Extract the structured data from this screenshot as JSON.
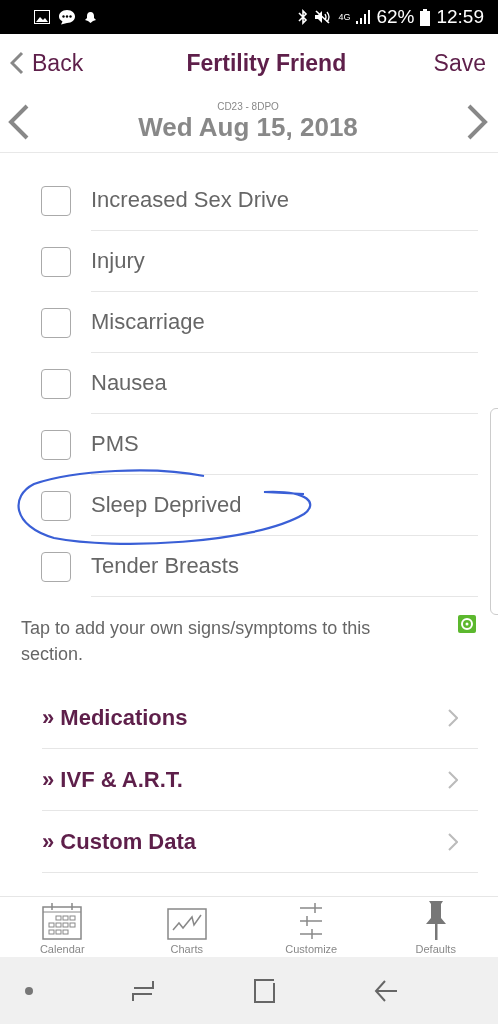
{
  "status_bar": {
    "network": "4G",
    "battery": "62%",
    "time": "12:59"
  },
  "header": {
    "back": "Back",
    "title": "Fertility Friend",
    "save": "Save"
  },
  "date_bar": {
    "cycle": "CD23 - 8DPO",
    "date": "Wed Aug 15, 2018"
  },
  "symptoms": [
    {
      "label": "Increased Sex Drive",
      "checked": false
    },
    {
      "label": "Injury",
      "checked": false
    },
    {
      "label": "Miscarriage",
      "checked": false
    },
    {
      "label": "Nausea",
      "checked": false
    },
    {
      "label": "PMS",
      "checked": false
    },
    {
      "label": "Sleep Deprived",
      "checked": false
    },
    {
      "label": "Tender Breasts",
      "checked": false
    }
  ],
  "note": "Tap to add your own signs/symptoms to this section.",
  "sections": [
    {
      "label": "» Medications"
    },
    {
      "label": "» IVF & A.R.T."
    },
    {
      "label": "» Custom Data"
    }
  ],
  "tab_bar": [
    {
      "kind": "calendar",
      "label": "Calendar"
    },
    {
      "kind": "charts",
      "label": "Charts"
    },
    {
      "kind": "customize",
      "label": "Customize"
    },
    {
      "kind": "defaults",
      "label": "Defaults"
    }
  ]
}
